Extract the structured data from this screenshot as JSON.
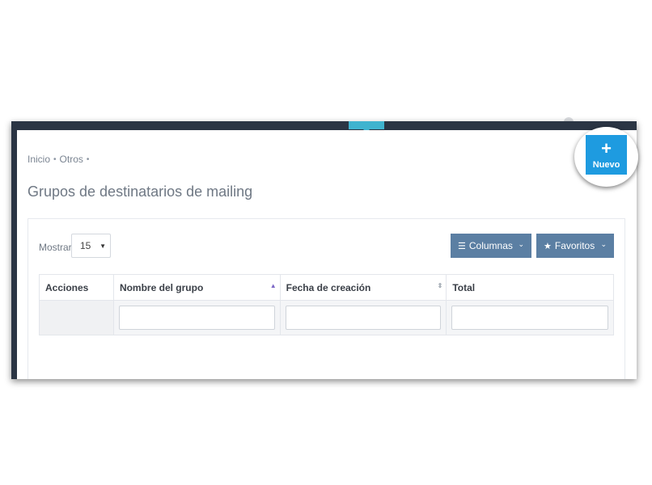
{
  "breadcrumb": {
    "items": [
      "Inicio",
      "Otros"
    ],
    "separator": "•"
  },
  "page_title": "Grupos de destinatarios de mailing",
  "toolbar": {
    "show_label": "Mostrar",
    "page_size": "15",
    "columns_label": "Columnas",
    "favorites_label": "Favoritos"
  },
  "table": {
    "headers": {
      "actions": "Acciones",
      "group_name": "Nombre del grupo",
      "created_date": "Fecha de creación",
      "total": "Total"
    }
  },
  "new_button": {
    "label": "Nuevo",
    "icon": "plus-icon"
  },
  "colors": {
    "accent": "#1e9be0",
    "toolbar_button": "#5b7fa3",
    "frame": "#2b3544",
    "top_tab": "#3fb3cf"
  }
}
